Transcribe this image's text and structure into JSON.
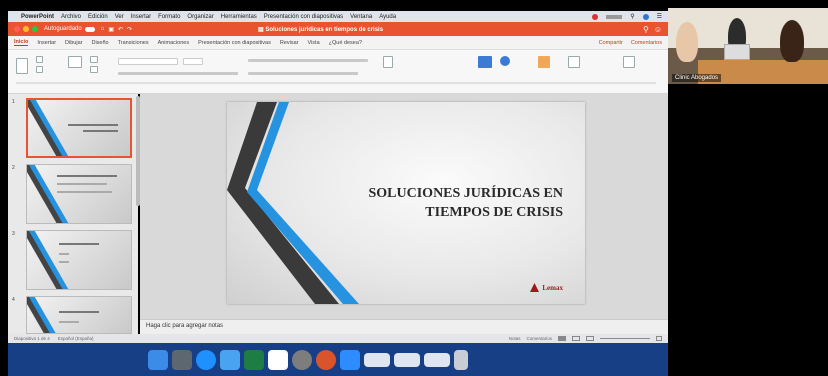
{
  "menubar": {
    "apple": "",
    "app_name": "PowerPoint",
    "items": [
      "Archivo",
      "Edición",
      "Ver",
      "Insertar",
      "Formato",
      "Organizar",
      "Herramientas",
      "Presentación con diapositivas",
      "Ventana",
      "Ayuda"
    ]
  },
  "titlebar": {
    "autosave": "Autoguardado",
    "title": "Soluciones jurídicas en tiempos de crisis"
  },
  "ribbon": {
    "tabs": [
      "Inicio",
      "Insertar",
      "Dibujar",
      "Diseño",
      "Transiciones",
      "Animaciones",
      "Presentación con diapositivas",
      "Revisar",
      "Vista",
      "¿Qué desea?"
    ],
    "share": "Compartir",
    "comments": "Comentarios"
  },
  "slides": [
    {
      "number": "1",
      "title": "Soluciones jurídicas en tiempos de crisis"
    },
    {
      "number": "2"
    },
    {
      "number": "3"
    },
    {
      "number": "4"
    }
  ],
  "main_slide": {
    "title_line1": "SOLUCIONES JURÍDICAS EN",
    "title_line2": "TIEMPOS DE CRISIS",
    "logo_text": "Lemax"
  },
  "notes": {
    "placeholder": "Haga clic para agregar notas"
  },
  "statusbar": {
    "slide_info": "Diapositiva 1 de 4",
    "language": "Español (España)",
    "notes_btn": "Notas",
    "comments_btn": "Comentarios"
  },
  "video": {
    "label": "Clinic Abogados"
  },
  "colors": {
    "accent": "#e8542f",
    "dock": "#173f85",
    "blue_stripe": "#2593e0"
  }
}
